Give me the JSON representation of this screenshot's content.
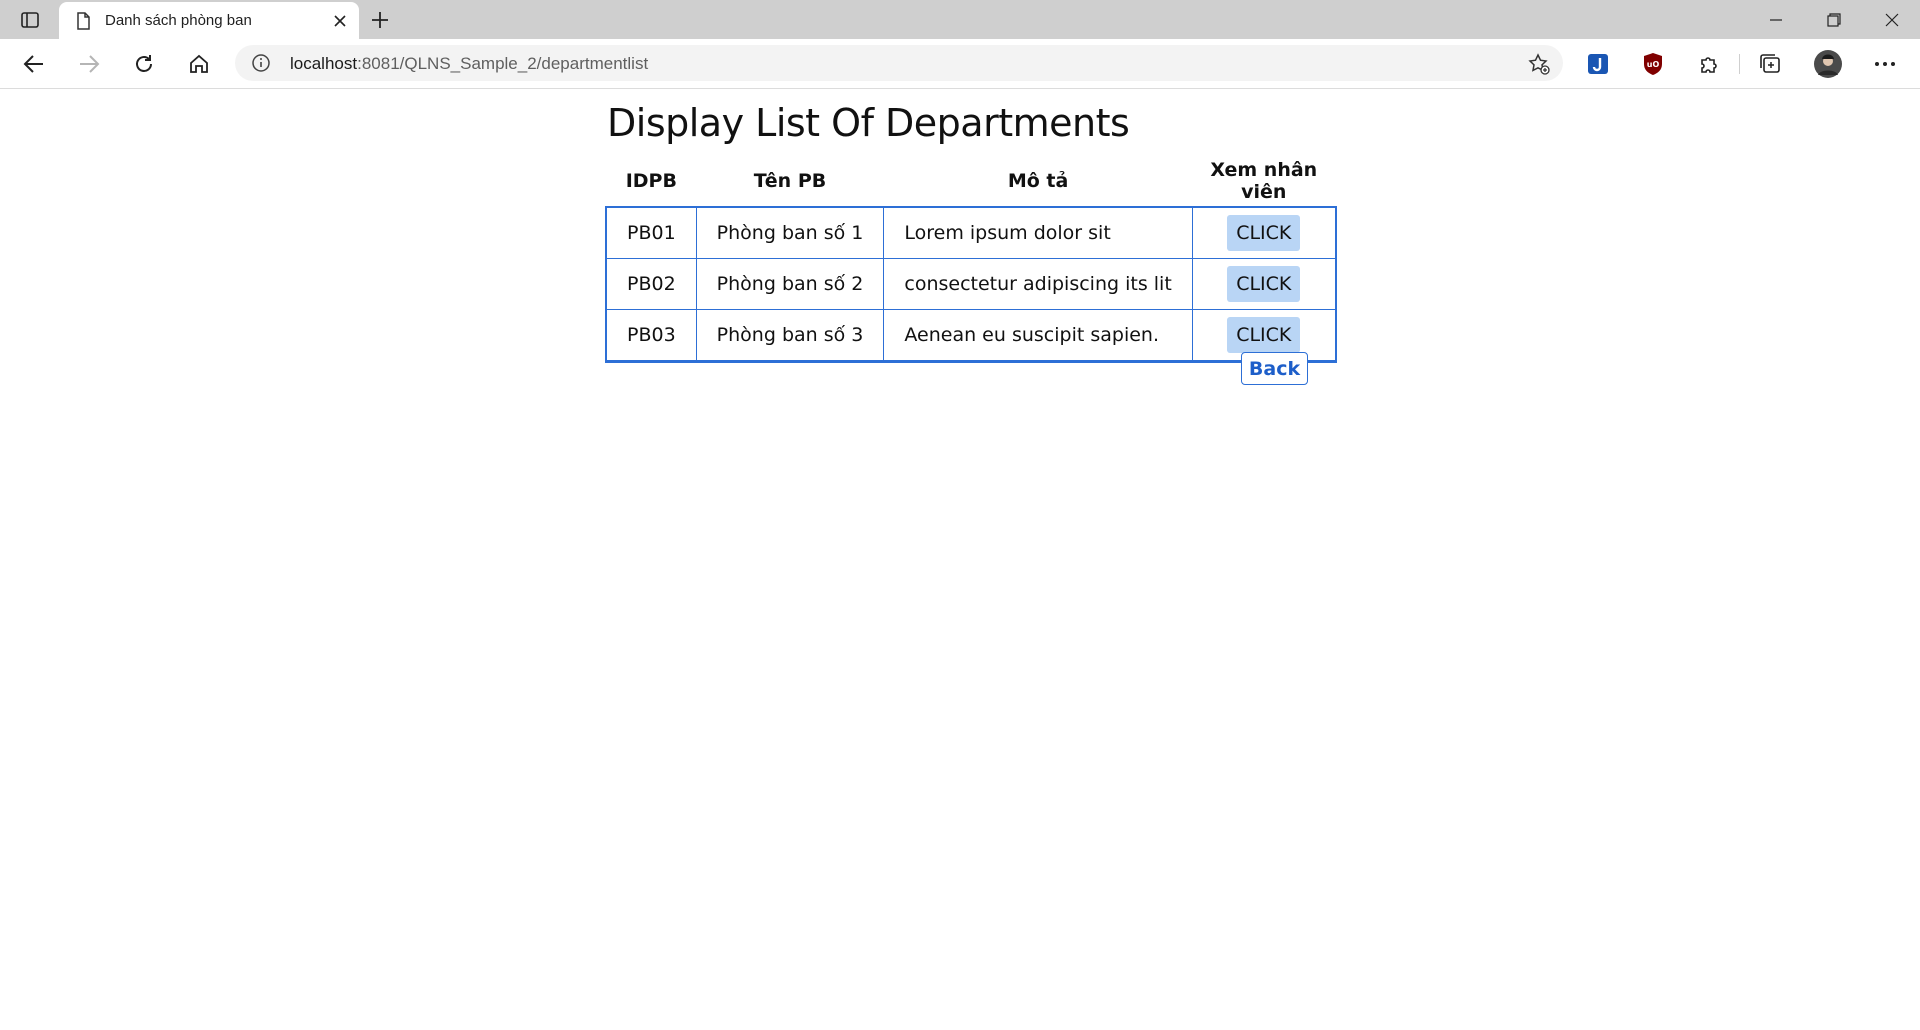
{
  "browser": {
    "tab": {
      "title": "Danh sách phòng ban"
    },
    "address": {
      "host": "localhost",
      "rest": ":8081/QLNS_Sample_2/departmentlist"
    }
  },
  "page": {
    "title": "Display List Of Departments",
    "table": {
      "headers": [
        "IDPB",
        "Tên PB",
        "Mô tả",
        "Xem nhân viên"
      ],
      "rows": [
        {
          "id": "PB01",
          "name": "Phòng ban số 1",
          "desc": "Lorem ipsum dolor sit",
          "action": "CLICK"
        },
        {
          "id": "PB02",
          "name": "Phòng ban số 2",
          "desc": "consectetur adipiscing its lit",
          "action": "CLICK"
        },
        {
          "id": "PB03",
          "name": "Phòng ban số 3",
          "desc": "Aenean eu suscipit sapien.",
          "action": "CLICK"
        }
      ]
    },
    "back_label": "Back"
  },
  "colors": {
    "accent": "#2d6fd6",
    "button_bg": "#b9d5f5",
    "chrome_bg": "#cfcfcf"
  }
}
